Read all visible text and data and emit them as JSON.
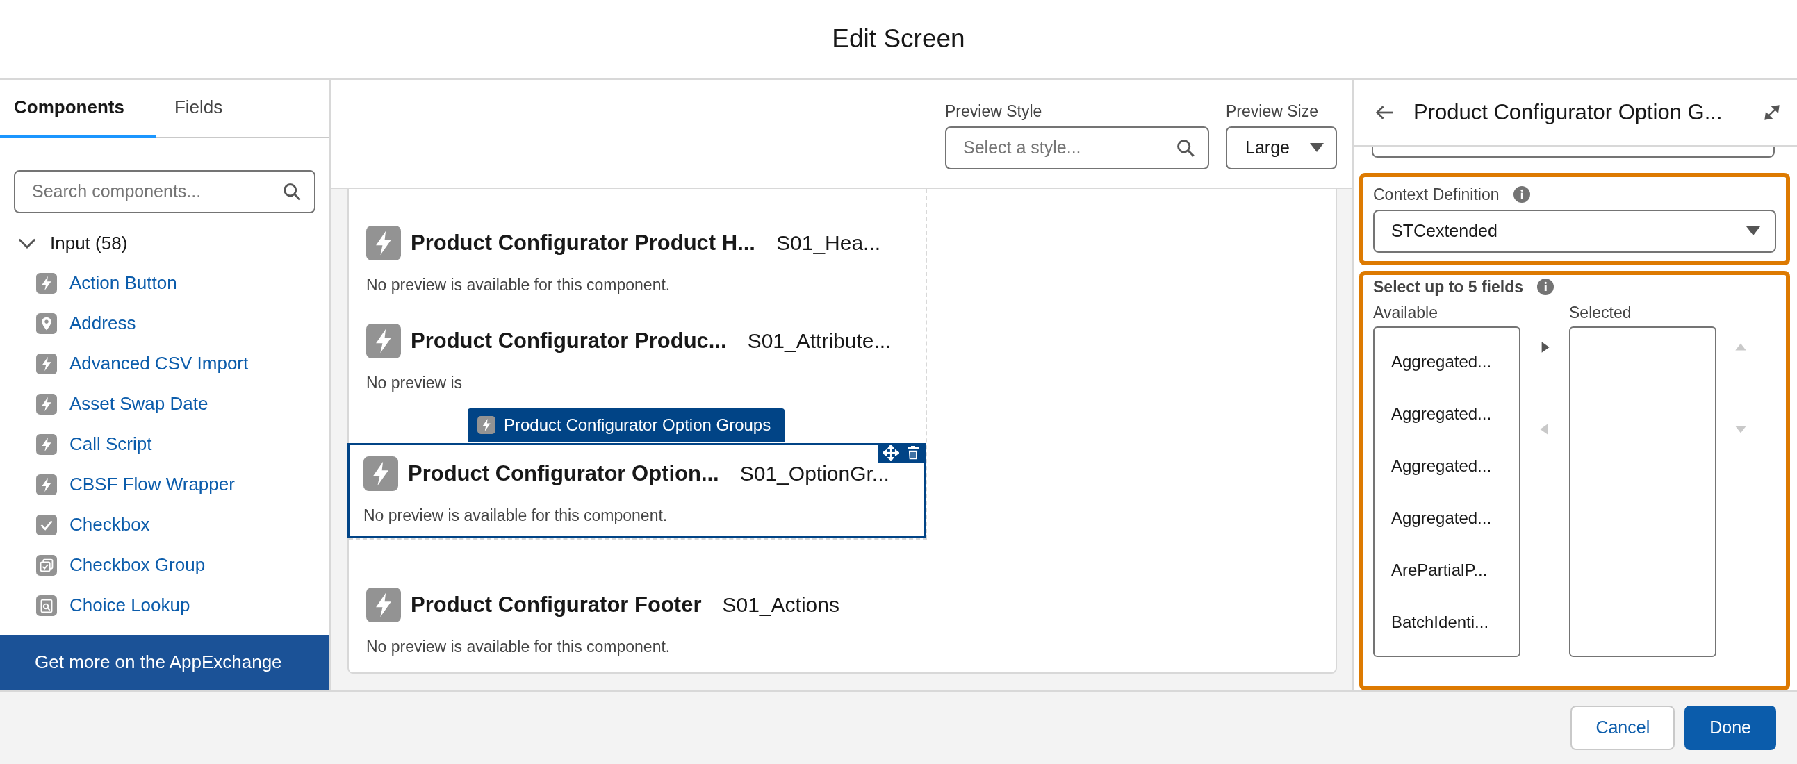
{
  "window": {
    "title": "Edit Screen"
  },
  "left_panel": {
    "tabs": [
      {
        "label": "Components",
        "selected": true
      },
      {
        "label": "Fields",
        "selected": false
      }
    ],
    "search": {
      "placeholder": "Search components..."
    },
    "group": {
      "label": "Input (58)",
      "expanded": true,
      "items": [
        {
          "label": "Action Button",
          "kind": "bolt"
        },
        {
          "label": "Address",
          "kind": "pin"
        },
        {
          "label": "Advanced CSV Import",
          "kind": "bolt"
        },
        {
          "label": "Asset Swap Date",
          "kind": "bolt"
        },
        {
          "label": "Call Script",
          "kind": "bolt"
        },
        {
          "label": "CBSF Flow Wrapper",
          "kind": "bolt"
        },
        {
          "label": "Checkbox",
          "kind": "check"
        },
        {
          "label": "Checkbox Group",
          "kind": "checkgroup"
        },
        {
          "label": "Choice Lookup",
          "kind": "lookup"
        }
      ]
    },
    "appexchange_link": "Get more on the AppExchange"
  },
  "canvas": {
    "preview_style": {
      "label": "Preview Style",
      "placeholder": "Select a style..."
    },
    "preview_size": {
      "label": "Preview Size",
      "value": "Large"
    },
    "components": [
      {
        "title": "Product Configurator Product H...",
        "api_name": "S01_Hea...",
        "message": "No preview is available for this component.",
        "selected": false
      },
      {
        "title": "Product Configurator Produc...",
        "api_name": "S01_Attribute...",
        "message": "No preview is",
        "selected": false
      },
      {
        "title": "Product Configurator Option...",
        "api_name": "S01_OptionGr...",
        "message": "No preview is available for this component.",
        "selected": true,
        "tag": "Product Configurator Option Groups"
      }
    ],
    "footer_component": {
      "title": "Product Configurator Footer",
      "api_name": "S01_Actions",
      "message": "No preview is available for this component."
    }
  },
  "properties": {
    "title": "Product Configurator Option G...",
    "context_definition": {
      "label": "Context Definition",
      "value": "STCextended",
      "highlighted": true
    },
    "field_picker": {
      "label": "Select up to 5 fields",
      "highlighted": true,
      "available_label": "Available",
      "selected_label": "Selected",
      "available": [
        "Aggregated...",
        "Aggregated...",
        "Aggregated...",
        "Aggregated...",
        "ArePartialP...",
        "BatchIdenti..."
      ],
      "buttons": [
        {
          "kind": "right",
          "disabled": false
        },
        {
          "kind": "left",
          "disabled": true
        },
        {
          "kind": "up",
          "disabled": true
        },
        {
          "kind": "down",
          "disabled": true
        }
      ]
    }
  },
  "footer": {
    "buttons": [
      {
        "label": "Cancel",
        "kind": "neutral"
      },
      {
        "label": "Done",
        "kind": "brand"
      }
    ]
  }
}
